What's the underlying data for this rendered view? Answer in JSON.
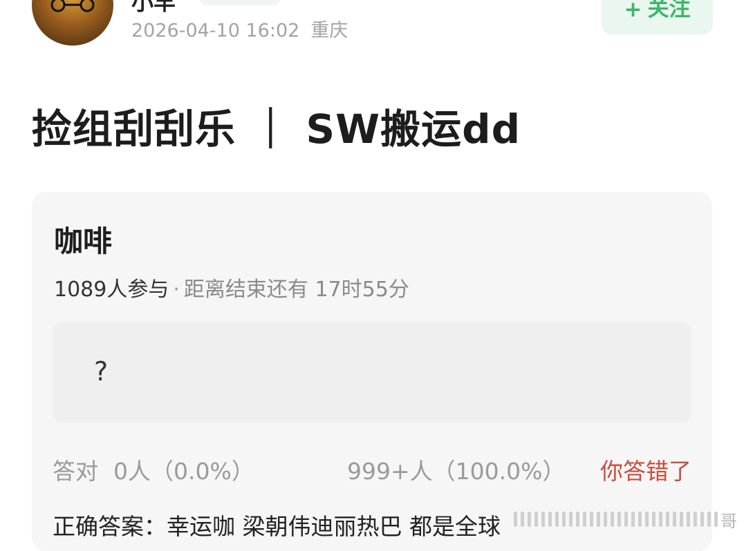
{
  "header": {
    "username": "小羊",
    "timestamp": "2026-04-10 16:02",
    "location": "重庆",
    "follow_plus": "+",
    "follow_label": "关注"
  },
  "post": {
    "title": "捡组刮刮乐 ｜ SW搬运dd"
  },
  "quiz": {
    "name": "咖啡",
    "participants": "1089人参与",
    "separator": "·",
    "remaining": "距离结束还有 17时55分",
    "question": "?",
    "correct_label": "答对",
    "correct_count": "0人（0.0%）",
    "wrong_count": "999+人（100.0%）",
    "my_result": "你答错了",
    "answer": "正确答案：幸运咖 梁朝伟迪丽热巴 都是全球"
  },
  "watermark": {
    "text": "哥"
  },
  "colors": {
    "follow_bg": "#e9f7ee",
    "follow_text": "#3db56b",
    "wrong_text": "#c94c3d",
    "card_bg": "#f6f6f6"
  }
}
